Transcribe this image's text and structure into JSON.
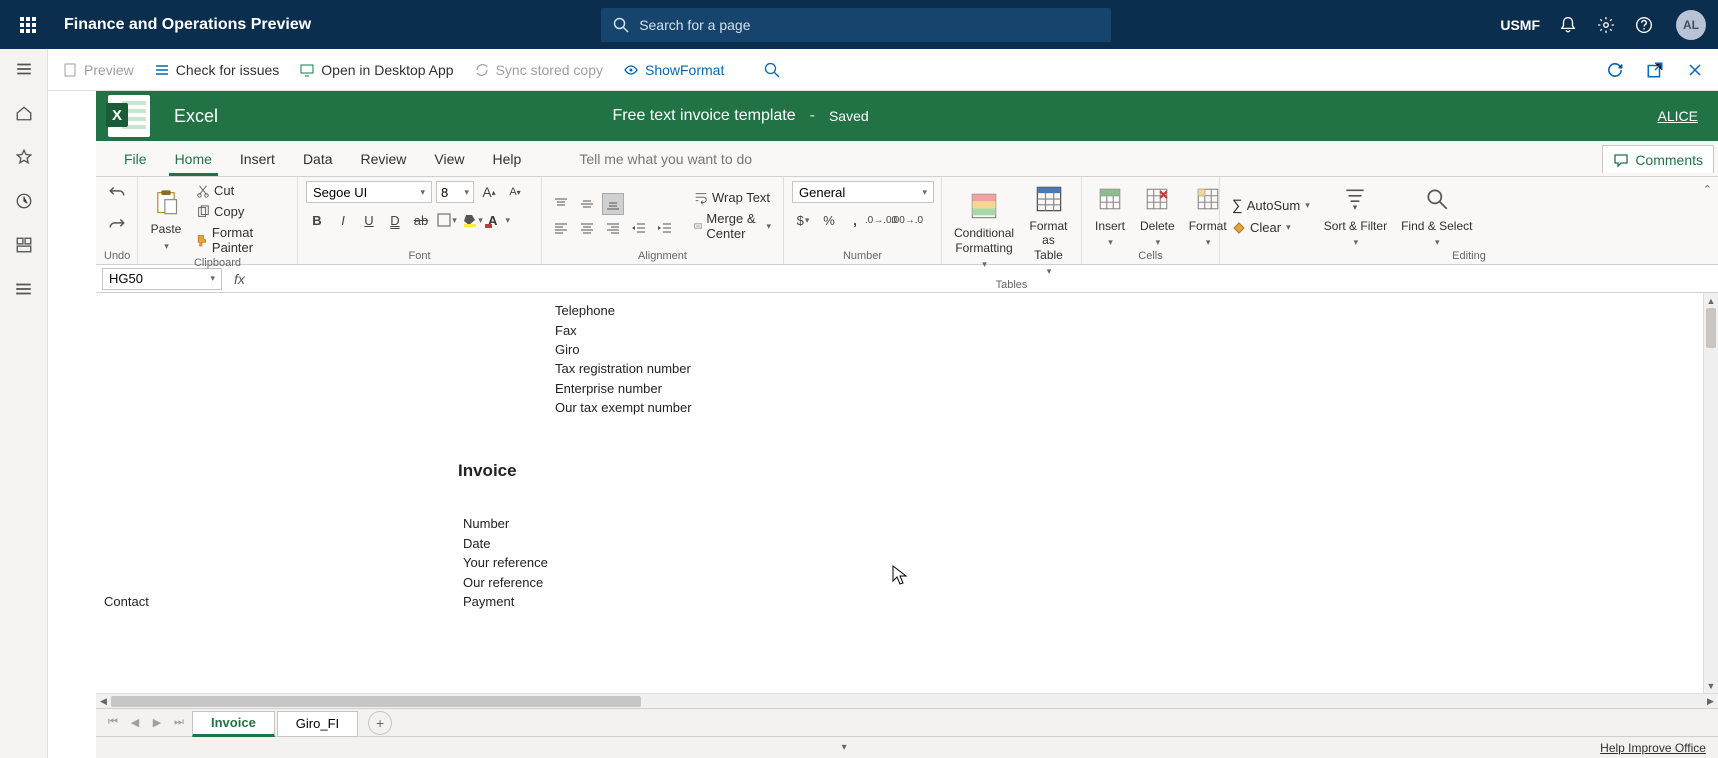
{
  "topbar": {
    "title": "Finance and Operations Preview",
    "search_placeholder": "Search for a page",
    "entity": "USMF",
    "avatar": "AL"
  },
  "cmdbar": {
    "preview": "Preview",
    "check": "Check for issues",
    "open_desktop": "Open in Desktop App",
    "sync": "Sync stored copy",
    "showformat": "ShowFormat"
  },
  "excel": {
    "app": "Excel",
    "doc": "Free text invoice template",
    "state": "Saved",
    "user": "ALICE"
  },
  "tabs": {
    "file": "File",
    "home": "Home",
    "insert": "Insert",
    "data": "Data",
    "review": "Review",
    "view": "View",
    "help": "Help",
    "tellme": "Tell me what you want to do",
    "comments": "Comments"
  },
  "ribbon": {
    "undo": "Undo",
    "paste": "Paste",
    "cut": "Cut",
    "copy": "Copy",
    "format_painter": "Format Painter",
    "clipboard": "Clipboard",
    "font_name": "Segoe UI",
    "font_size": "8",
    "font": "Font",
    "wrap": "Wrap Text",
    "merge": "Merge & Center",
    "alignment": "Alignment",
    "numfmt": "General",
    "number": "Number",
    "cond": "Conditional Formatting",
    "astable": "Format as Table",
    "tables": "Tables",
    "insert_c": "Insert",
    "delete_c": "Delete",
    "format_c": "Format",
    "cells": "Cells",
    "autosum": "AutoSum",
    "clear": "Clear",
    "sort": "Sort & Filter",
    "find": "Find & Select",
    "editing": "Editing"
  },
  "fx": {
    "name": "HG50",
    "formula": ""
  },
  "sheet": {
    "c1": "Telephone",
    "c2": "Fax",
    "c3": "Giro",
    "c4": "Tax registration number",
    "c5": "Enterprise number",
    "c6": "Our tax exempt number",
    "h1": "Invoice",
    "d1": "Number",
    "d2": "Date",
    "d3": "Your reference",
    "d4": "Our reference",
    "d5": "Payment",
    "contact": "Contact"
  },
  "sheets": {
    "s1": "Invoice",
    "s2": "Giro_FI"
  },
  "status": {
    "hio": "Help Improve Office"
  }
}
